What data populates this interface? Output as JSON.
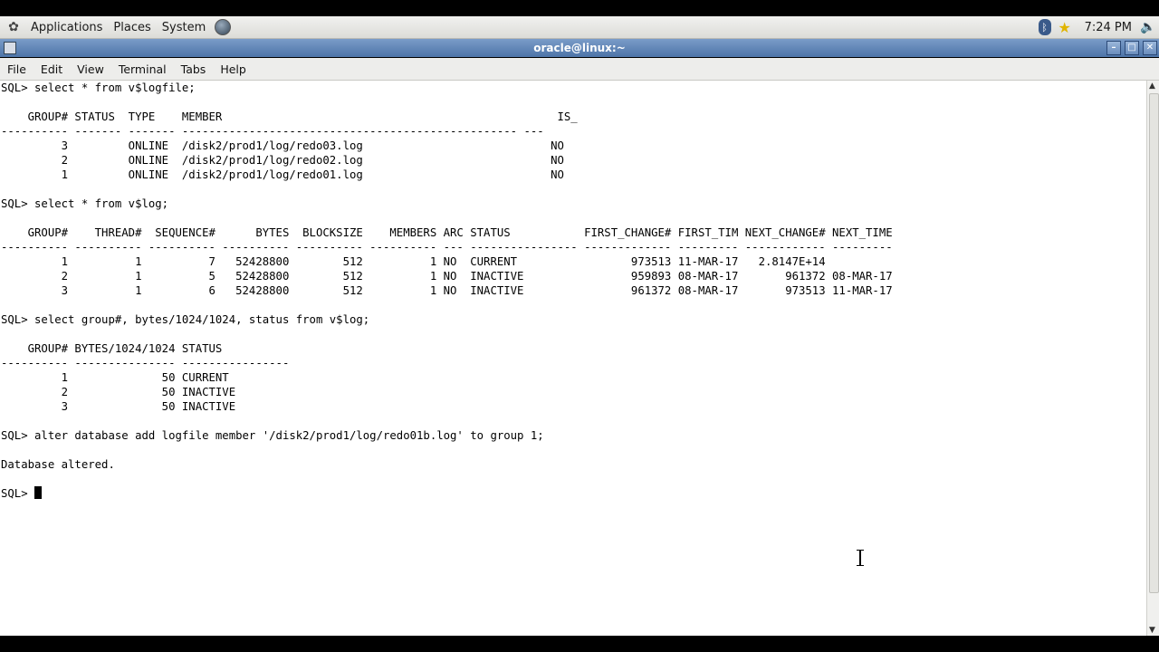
{
  "panel": {
    "menus": [
      "Applications",
      "Places",
      "System"
    ],
    "clock": "7:24 PM",
    "icons": [
      "gnome-foot-icon",
      "web-browser-icon",
      "bluetooth-icon",
      "star-icon",
      "volume-icon"
    ]
  },
  "window": {
    "title": "oracle@linux:~",
    "controls": [
      "minimize",
      "maximize",
      "close"
    ]
  },
  "menubar": {
    "items": [
      "File",
      "Edit",
      "View",
      "Terminal",
      "Tabs",
      "Help"
    ]
  },
  "terminal": {
    "lines": [
      "SQL> select * from v$logfile;",
      "",
      "    GROUP# STATUS  TYPE    MEMBER                                                  IS_",
      "---------- ------- ------- -------------------------------------------------- ---",
      "         3         ONLINE  /disk2/prod1/log/redo03.log                            NO",
      "         2         ONLINE  /disk2/prod1/log/redo02.log                            NO",
      "         1         ONLINE  /disk2/prod1/log/redo01.log                            NO",
      "",
      "SQL> select * from v$log;",
      "",
      "    GROUP#    THREAD#  SEQUENCE#      BYTES  BLOCKSIZE    MEMBERS ARC STATUS           FIRST_CHANGE# FIRST_TIM NEXT_CHANGE# NEXT_TIME",
      "---------- ---------- ---------- ---------- ---------- ---------- --- ---------------- ------------- --------- ------------ ---------",
      "         1          1          7   52428800        512          1 NO  CURRENT                 973513 11-MAR-17   2.8147E+14",
      "         2          1          5   52428800        512          1 NO  INACTIVE                959893 08-MAR-17       961372 08-MAR-17",
      "         3          1          6   52428800        512          1 NO  INACTIVE                961372 08-MAR-17       973513 11-MAR-17",
      "",
      "SQL> select group#, bytes/1024/1024, status from v$log;",
      "",
      "    GROUP# BYTES/1024/1024 STATUS",
      "---------- --------------- ----------------",
      "         1              50 CURRENT",
      "         2              50 INACTIVE",
      "         3              50 INACTIVE",
      "",
      "SQL> alter database add logfile member '/disk2/prod1/log/redo01b.log' to group 1;",
      "",
      "Database altered.",
      ""
    ],
    "prompt": "SQL> "
  }
}
